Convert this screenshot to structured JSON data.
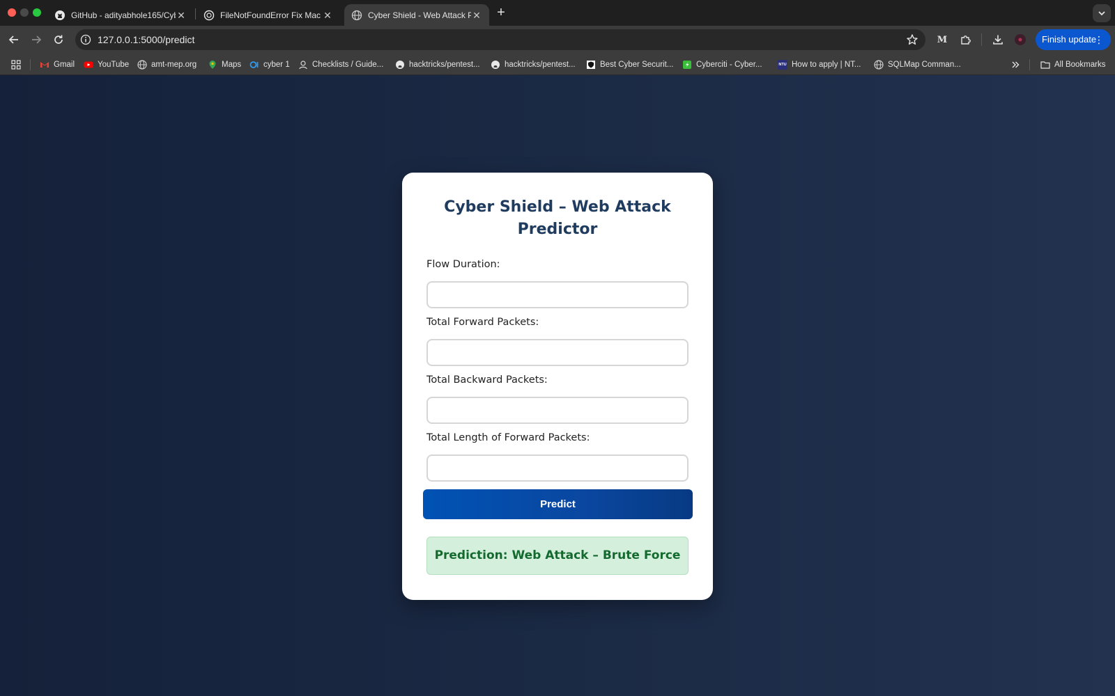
{
  "browser": {
    "tabs": [
      {
        "title": "GitHub - adityabhole165/Cyb",
        "icon": "github-icon"
      },
      {
        "title": "FileNotFoundError Fix Mac",
        "icon": "openai-icon"
      },
      {
        "title": "Cyber Shield - Web Attack Pr",
        "icon": "globe-icon",
        "active": true
      }
    ],
    "address": "127.0.0.1:5000/predict",
    "finish_update_label": "Finish update",
    "extension_letter": "M",
    "bookmarks": [
      {
        "label": "Gmail",
        "icon": "gmail-icon"
      },
      {
        "label": "YouTube",
        "icon": "youtube-icon"
      },
      {
        "label": "amt-mep.org",
        "icon": "globe-icon"
      },
      {
        "label": "Maps",
        "icon": "maps-icon"
      },
      {
        "label": "cyber 1",
        "icon": "o1-icon"
      },
      {
        "label": "Checklists / Guide...",
        "icon": "checklist-icon"
      },
      {
        "label": "hacktricks/pentest...",
        "icon": "github-icon"
      },
      {
        "label": "hacktricks/pentest...",
        "icon": "github-icon"
      },
      {
        "label": "Best Cyber Securit...",
        "icon": "shield-icon"
      },
      {
        "label": "Cyberciti - Cyber...",
        "icon": "cyberciti-icon"
      },
      {
        "label": "How to apply | NT...",
        "icon": "ntu-icon"
      },
      {
        "label": "SQLMap Comman...",
        "icon": "globe-icon"
      }
    ],
    "all_bookmarks_label": "All Bookmarks",
    "ntu_badge": "NTU"
  },
  "app": {
    "title": "Cyber Shield – Web Attack Predictor",
    "fields": [
      {
        "label": "Flow Duration:",
        "value": ""
      },
      {
        "label": "Total Forward Packets:",
        "value": ""
      },
      {
        "label": "Total Backward Packets:",
        "value": ""
      },
      {
        "label": "Total Length of Forward Packets:",
        "value": ""
      }
    ],
    "predict_label": "Predict",
    "result_text": "Prediction: Web Attack – Brute Force"
  },
  "colors": {
    "accent": "#0b57d0",
    "title": "#1f3b5e",
    "result_bg": "#d4f0dc",
    "result_text": "#146a2e"
  }
}
